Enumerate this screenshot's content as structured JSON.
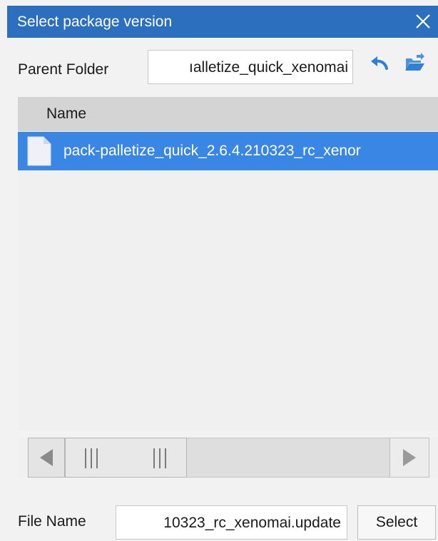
{
  "dialog": {
    "title": "Select package version",
    "close_icon": "close-icon"
  },
  "parent_folder": {
    "label": "Parent Folder",
    "value": "palletize_quick_xenomai",
    "visible_value": "ıalletize_quick_xenomai",
    "back_icon": "back-arrow-icon",
    "folder_icon": "open-folder-icon"
  },
  "file_list": {
    "column_header": "Name",
    "rows": [
      {
        "name": "pack-palletize_quick_2.6.4.210323_rc_xenor",
        "icon": "file-icon",
        "selected": true
      }
    ]
  },
  "scrollbar": {
    "left_icon": "scroll-left-arrow-icon",
    "right_icon": "scroll-right-arrow-icon",
    "grip_icon": "grip-icon"
  },
  "file_name": {
    "label": "File Name",
    "value": "10323_rc_xenomai.update"
  },
  "buttons": {
    "select": "Select"
  },
  "colors": {
    "titlebar": "#2c6fbf",
    "selection": "#3a86e4",
    "icon_blue": "#2f7fd8",
    "header": "#d4d4d4"
  }
}
